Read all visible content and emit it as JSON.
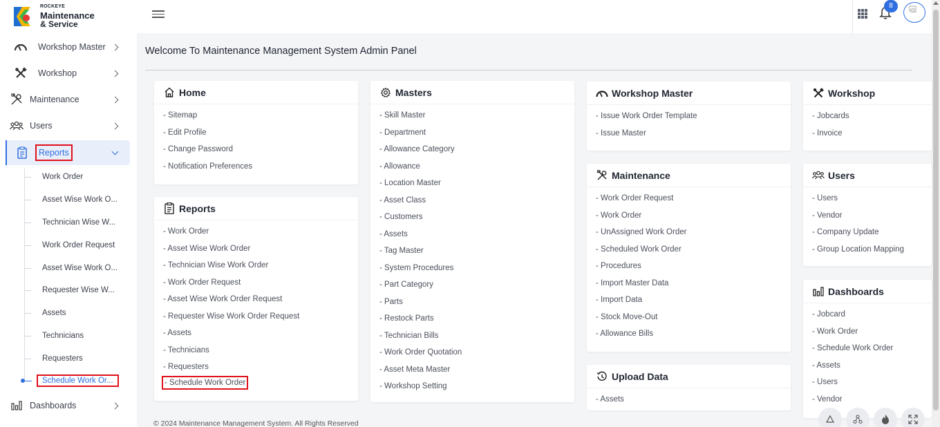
{
  "brand": {
    "small": "ROCKEYE",
    "line1": "Maintenance",
    "line2": "& Service"
  },
  "notifications": {
    "count": "8"
  },
  "sidebar": {
    "items": [
      {
        "label": "Workshop Master"
      },
      {
        "label": "Workshop"
      },
      {
        "label": "Maintenance"
      },
      {
        "label": "Users"
      },
      {
        "label": "Reports"
      },
      {
        "label": "Dashboards"
      }
    ],
    "report_subitems": [
      "Work Order",
      "Asset Wise Work O...",
      "Technician Wise W...",
      "Work Order Request",
      "Asset Wise Work O...",
      "Requester Wise W...",
      "Assets",
      "Technicians",
      "Requesters",
      "Schedule Work Or..."
    ]
  },
  "main": {
    "title": "Welcome To Maintenance Management System Admin Panel",
    "cards": {
      "home": {
        "title": "Home",
        "links": [
          "- Sitemap",
          "- Edit Profile",
          "- Change Password",
          "- Notification Preferences"
        ]
      },
      "reports": {
        "title": "Reports",
        "links": [
          "- Work Order",
          "- Asset Wise Work Order",
          "- Technician Wise Work Order",
          "- Work Order Request",
          "- Asset Wise Work Order Request",
          "- Requester Wise Work Order Request",
          "- Assets",
          "- Technicians",
          "- Requesters",
          "- Schedule Work Order"
        ]
      },
      "masters": {
        "title": "Masters",
        "links": [
          "- Skill Master",
          "- Department",
          "- Allowance Category",
          "- Allowance",
          "- Location Master",
          "- Asset Class",
          "- Customers",
          "- Assets",
          "- Tag Master",
          "- System Procedures",
          "- Part Category",
          "- Parts",
          "- Restock Parts",
          "- Technician Bills",
          "- Work Order Quotation",
          "- Asset Meta Master",
          "- Workshop Setting"
        ]
      },
      "workshop_master": {
        "title": "Workshop Master",
        "links": [
          "- Issue Work Order Template",
          "- Issue Master"
        ]
      },
      "maintenance": {
        "title": "Maintenance",
        "links": [
          "- Work Order Request",
          "- Work Order",
          "- UnAssigned Work Order",
          "- Scheduled Work Order",
          "- Procedures",
          "- Import Master Data",
          "- Import Data",
          "- Stock Move-Out",
          "- Allowance Bills"
        ]
      },
      "upload_data": {
        "title": "Upload Data",
        "links": [
          "- Assets"
        ]
      },
      "workshop": {
        "title": "Workshop",
        "links": [
          "- Jobcards",
          "- Invoice"
        ]
      },
      "users": {
        "title": "Users",
        "links": [
          "- Users",
          "- Vendor",
          "- Company Update",
          "- Group Location Mapping"
        ]
      },
      "dashboards": {
        "title": "Dashboards",
        "links": [
          "- Jobcard",
          "- Work Order",
          "- Schedule Work Order",
          "- Assets",
          "- Users",
          "- Vendor"
        ]
      }
    }
  },
  "footer": {
    "text": "© 2024 Maintenance Management System. All Rights Reserved"
  },
  "colors": {
    "accent": "#2f6fe0",
    "highlight": "#e0101a"
  }
}
